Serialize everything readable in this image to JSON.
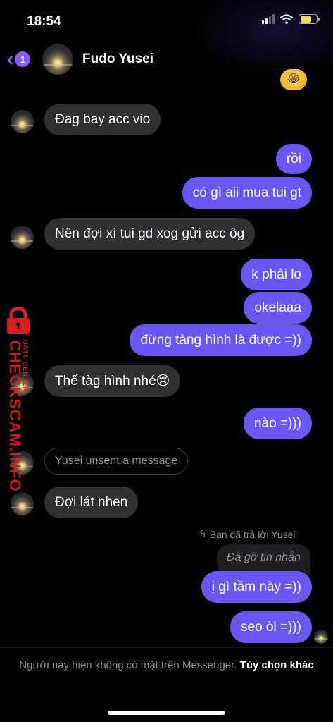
{
  "status_bar": {
    "time": "18:54"
  },
  "header": {
    "back_badge": "1",
    "contact_name": "Fudo Yusei"
  },
  "messages": [
    {
      "side": "in",
      "text": "Đag bay acc vio"
    },
    {
      "side": "out",
      "text": "rồi"
    },
    {
      "side": "out",
      "text": "có gì aii mua tui gt"
    },
    {
      "side": "in",
      "text": "Nên đợi xí tui gd xog gửi acc ôg"
    },
    {
      "side": "out",
      "text": "k phải lo"
    },
    {
      "side": "out",
      "text": "okelaaa"
    },
    {
      "side": "out",
      "text": "đừng tàng hình là được =))"
    },
    {
      "side": "in",
      "text": "Thế tàg hình nhé😢"
    },
    {
      "side": "out",
      "text": "nào =)))"
    },
    {
      "side": "in",
      "text": "Yusei unsent a message"
    },
    {
      "side": "in",
      "text": "Đợi lát nhen"
    },
    {
      "side": "out",
      "text": "ị gì tầm này =))"
    },
    {
      "side": "out",
      "text": "seo òi =)))"
    }
  ],
  "reply": {
    "label": "Bạn đã trả lời Yusei",
    "quoted": "Đã gỡ tin nhắn"
  },
  "watermark": {
    "text": "CHECKSCAM.INFO",
    "sub": "DATA CENTER"
  },
  "footer": {
    "notice": "Người này hiện không có mặt trên Messenger.",
    "action": "Tùy chọn khác"
  },
  "colors": {
    "accent": "#8a5cf5",
    "outgoing_bubble": "#6a57f1",
    "incoming_bubble": "#303032"
  }
}
